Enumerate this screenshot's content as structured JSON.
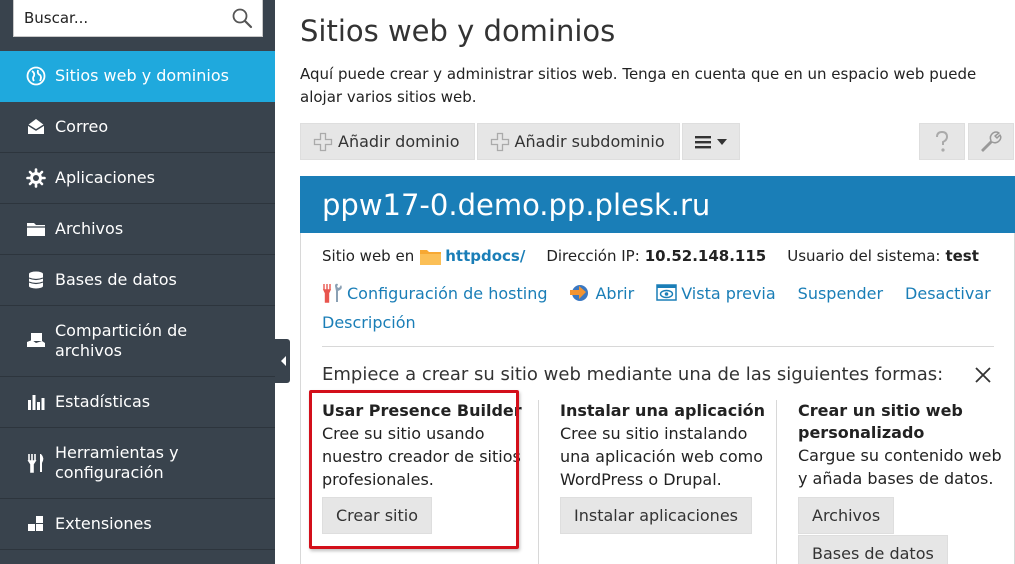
{
  "search": {
    "placeholder": "Buscar..."
  },
  "sidebar": {
    "items": [
      {
        "label": "Sitios web y dominios",
        "icon": "globe-icon",
        "active": true
      },
      {
        "label": "Correo",
        "icon": "mail-icon"
      },
      {
        "label": "Aplicaciones",
        "icon": "gear-icon"
      },
      {
        "label": "Archivos",
        "icon": "folder-icon"
      },
      {
        "label": "Bases de datos",
        "icon": "database-icon"
      },
      {
        "label": "Compartición de archivos",
        "icon": "file-share-icon"
      },
      {
        "label": "Estadísticas",
        "icon": "bar-chart-icon"
      },
      {
        "label": "Herramientas y configuración",
        "icon": "tools-icon"
      },
      {
        "label": "Extensiones",
        "icon": "extensions-icon"
      }
    ]
  },
  "main": {
    "title": "Sitios web y dominios",
    "description": "Aquí puede crear y administrar sitios web. Tenga en cuenta que en un espacio web puede alojar varios sitios web."
  },
  "toolbar": {
    "add_domain": "Añadir dominio",
    "add_subdomain": "Añadir subdominio"
  },
  "domain": {
    "name": "ppw17-0.demo.pp.plesk.ru",
    "site_label": "Sitio web en",
    "site_path": "httpdocs/",
    "ip_label": "Dirección IP:",
    "ip_value": "10.52.148.115",
    "user_label": "Usuario del sistema:",
    "user_value": "test",
    "links": {
      "hosting": "Configuración de hosting",
      "open": "Abrir",
      "preview": "Vista previa",
      "suspend": "Suspender",
      "deactivate": "Desactivar",
      "description": "Descripción"
    }
  },
  "start": {
    "heading": "Empiece a crear su sitio web mediante una de las siguientes formas:",
    "options": [
      {
        "title": "Usar Presence Builder",
        "lines": [
          "Cree su sitio usando",
          "nuestro creador de sitios",
          "profesionales."
        ],
        "button": "Crear sitio"
      },
      {
        "title": "Instalar una aplicación",
        "lines": [
          "Cree su sitio instalando",
          "una aplicación web como",
          "WordPress o Drupal."
        ],
        "button": "Instalar aplicaciones"
      },
      {
        "title_lines": [
          "Crear un sitio web",
          "personalizado"
        ],
        "lines": [
          "Cargue su contenido web",
          "y añada bases de datos."
        ],
        "buttons": [
          "Archivos",
          "Bases de datos"
        ]
      }
    ]
  },
  "colors": {
    "sidebar_bg": "#39434d",
    "active_item": "#1fa9dd",
    "domain_header": "#1a7eb7",
    "link": "#1a7eb7",
    "highlight": "#d30f1a"
  }
}
